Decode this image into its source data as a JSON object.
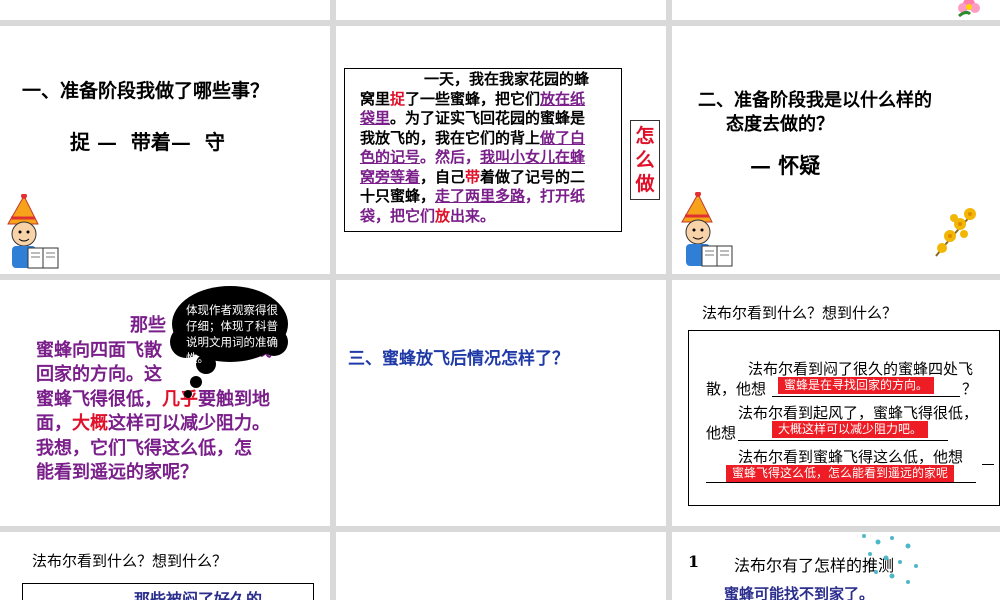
{
  "slides": {
    "s4": {
      "title": "一、准备阶段我做了哪些事？",
      "steps": "捉 —  带着—  守"
    },
    "s5": {
      "p1": "一天，我在我家花园的蜂",
      "p2a": "窝里",
      "p2b": "捉",
      "p2c": "了一些蜜蜂，把它们",
      "p2d": "放在纸",
      "p3a": "袋里",
      "p3b": "。为了证实飞回花园的蜜蜂是",
      "p4a": "我放飞的，我在它们的背上",
      "p4b": "做了白",
      "p5a": "色的记号",
      "p5b": "。然后，",
      "p5c": "我叫小女儿在蜂",
      "p6a": "窝旁等着",
      "p6b": "，自己",
      "p6c": "带",
      "p6d": "着做了记号的二",
      "p7a": "十只蜜蜂，",
      "p7b": "走了两里多路",
      "p7c": "，打开纸",
      "p8a": "袋，把它们",
      "p8b": "放",
      "p8c": "出来。",
      "side_label": "怎么做"
    },
    "s6": {
      "title_line1": "二、准备阶段我是以什么样的",
      "title_line2": "态度去做的？",
      "answer": "— 怀疑"
    },
    "s7": {
      "l1": "那些",
      "l2": "蜜蜂向四面飞散",
      "l2b": "找",
      "l3": "回家的方向。这",
      "l4a": "蜜蜂飞得很低，",
      "l4b": "几乎",
      "l4c": "要触到地",
      "l5a": "面，",
      "l5b": "大概",
      "l5c": "这样可以减少阻力。",
      "l6": "我想，它们飞得这么低，怎",
      "l7": "能看到遥远的家呢？",
      "bubble": "体现作者观察得很仔细；体现了科普说明文用词的准确性。"
    },
    "s8": {
      "question": "三、蜜蜂放飞后情况怎样了？"
    },
    "s9": {
      "title": "法布尔看到什么？想到什么？",
      "r1a": "法布尔看到闷了很久的蜜蜂四处飞",
      "r1b": "散，他想",
      "r1end": "？",
      "r1ans": "蜜蜂是在寻找回家的方向。",
      "r2a": "法布尔看到起风了，蜜蜂飞得很低，",
      "r2b": "他想",
      "r2ans": "大概这样可以减少阻力吧。",
      "r3a": "法布尔看到蜜蜂飞得这么低，他想",
      "r3ans": "蜜蜂飞得这么低，怎么能看到遥远的家呢"
    },
    "s10": {
      "title": "法布尔看到什么？想到什么？",
      "preview": "那些被闷了好久的"
    },
    "s12": {
      "num": "1",
      "title": "法布尔有了怎样的推测",
      "answer": "蜜蜂可能找不到家了。"
    }
  }
}
